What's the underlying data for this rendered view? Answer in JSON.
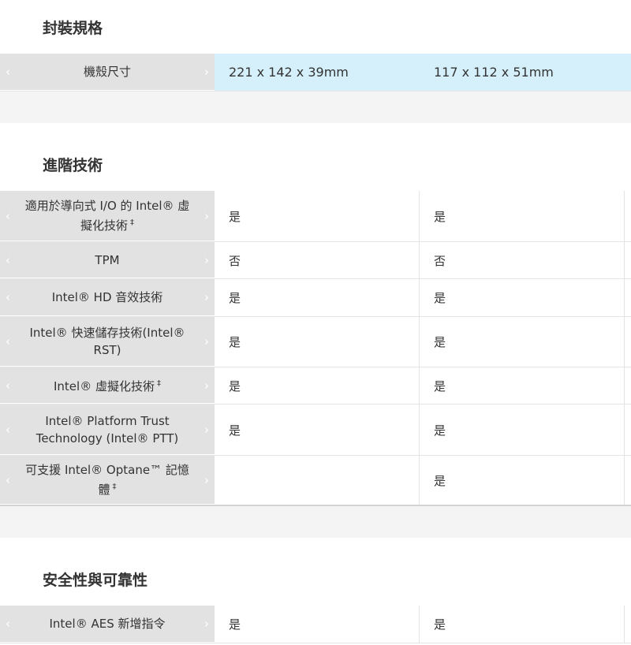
{
  "sections": {
    "packaging": {
      "title": "封裝規格",
      "rows": [
        {
          "label": "機殼尺寸",
          "values": [
            "221 x 142 x 39mm",
            "117 x 112 x 51mm"
          ]
        }
      ]
    },
    "advanced": {
      "title": "進階技術",
      "rows": [
        {
          "label": "適用於導向式 I/O 的 Intel® 虛擬化技術",
          "dagger": "‡",
          "values": [
            "是",
            "是"
          ]
        },
        {
          "label": "TPM",
          "values": [
            "否",
            "否"
          ]
        },
        {
          "label": "Intel® HD 音效技術",
          "values": [
            "是",
            "是"
          ]
        },
        {
          "label": "Intel® 快速儲存技術(Intel® RST)",
          "values": [
            "是",
            "是"
          ]
        },
        {
          "label": "Intel® 虛擬化技術",
          "dagger": "‡",
          "values": [
            "是",
            "是"
          ]
        },
        {
          "label": "Intel® Platform Trust Technology (Intel® PTT)",
          "values": [
            "是",
            "是"
          ]
        },
        {
          "label": "可支援 Intel® Optane™ 記憶體",
          "dagger": "‡",
          "values": [
            "",
            "是"
          ]
        }
      ]
    },
    "security": {
      "title": "安全性與可靠性",
      "rows": [
        {
          "label": "Intel® AES 新增指令",
          "values": [
            "是",
            "是"
          ]
        }
      ]
    }
  },
  "icons": {
    "prev": "chevron-left-icon",
    "next": "chevron-right-icon"
  },
  "colors": {
    "label_bg": "#e2e2e2",
    "highlight_bg": "#d5f0fb",
    "gap_bg": "#f4f4f4"
  }
}
